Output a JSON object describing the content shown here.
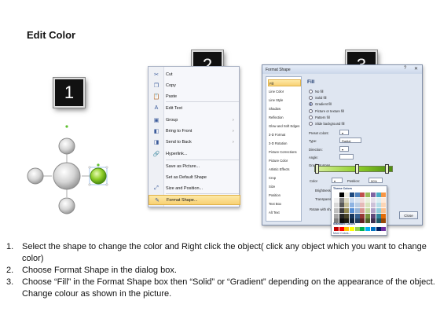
{
  "title": "Edit Color",
  "badges": [
    "1",
    "2",
    "3"
  ],
  "context_menu": {
    "items": [
      {
        "label": "Cut",
        "icon": "scissors-icon",
        "glyph": "✂",
        "submenu": false,
        "highlighted": false
      },
      {
        "label": "Copy",
        "icon": "copy-icon",
        "glyph": "❐",
        "submenu": false,
        "highlighted": false
      },
      {
        "label": "Paste",
        "icon": "paste-icon",
        "glyph": "📋",
        "submenu": false,
        "highlighted": false
      },
      {
        "label": "Edit Text",
        "icon": "edit-text-icon",
        "glyph": "A",
        "submenu": false,
        "highlighted": false
      },
      {
        "label": "Group",
        "icon": "group-icon",
        "glyph": "▣",
        "submenu": true,
        "highlighted": false
      },
      {
        "label": "Bring to Front",
        "icon": "bring-front-icon",
        "glyph": "◧",
        "submenu": true,
        "highlighted": false
      },
      {
        "label": "Send to Back",
        "icon": "send-back-icon",
        "glyph": "◨",
        "submenu": true,
        "highlighted": false
      },
      {
        "label": "Hyperlink...",
        "icon": "hyperlink-icon",
        "glyph": "🔗",
        "submenu": false,
        "highlighted": false
      },
      {
        "label": "Save as Picture...",
        "icon": "",
        "glyph": "",
        "submenu": false,
        "highlighted": false
      },
      {
        "label": "Set as Default Shape",
        "icon": "",
        "glyph": "",
        "submenu": false,
        "highlighted": false
      },
      {
        "label": "Size and Position...",
        "icon": "size-icon",
        "glyph": "⤢",
        "submenu": false,
        "highlighted": false
      },
      {
        "label": "Format Shape...",
        "icon": "format-shape-icon",
        "glyph": "✎",
        "submenu": false,
        "highlighted": true
      }
    ]
  },
  "dialog": {
    "title": "Format Shape",
    "controls": [
      "?",
      "✕"
    ],
    "nav": [
      "Fill",
      "Line Color",
      "Line Style",
      "Shadow",
      "Reflection",
      "Glow and Soft Edges",
      "3-D Format",
      "3-D Rotation",
      "Picture Corrections",
      "Picture Color",
      "Artistic Effects",
      "Crop",
      "Size",
      "Position",
      "Text Box",
      "Alt Text"
    ],
    "section": "Fill",
    "options": [
      {
        "label": "No fill",
        "on": false
      },
      {
        "label": "Solid fill",
        "on": false
      },
      {
        "label": "Gradient fill",
        "on": true
      },
      {
        "label": "Picture or texture fill",
        "on": false
      },
      {
        "label": "Pattern fill",
        "on": false
      },
      {
        "label": "Slide background fill",
        "on": false
      }
    ],
    "preset_label": "Preset colors:",
    "type_label": "Type:",
    "type_value": "Radial",
    "direction_label": "Direction:",
    "angle_label": "Angle:",
    "gradient_stops_label": "Gradient stops",
    "color_label": "Color",
    "position_label": "Position:",
    "position_value": "50%",
    "brightness_label": "Brightness:",
    "transparency_label": "Transparency:",
    "rotate_label": "Rotate with shape",
    "close_label": "Close",
    "palette": {
      "theme_title": "Theme Colors",
      "standard_title": "Standard Colors",
      "more_label": "More Colors..."
    }
  },
  "steps": [
    {
      "n": "1.",
      "text": "Select the shape to change the color and Right click the object( click any object which you want to change color)"
    },
    {
      "n": "2.",
      "text": "Choose Format Shape in the dialog box."
    },
    {
      "n": "3.",
      "text": "Choose “Fill” in the Format Shape box then “Solid” or “Gradient” depending on the appearance of the object. Change colour as shown in the picture."
    }
  ],
  "colors": {
    "accent_green": "#8fcf2a",
    "highlight": "#f8d073",
    "badge_bg": "#111111"
  }
}
